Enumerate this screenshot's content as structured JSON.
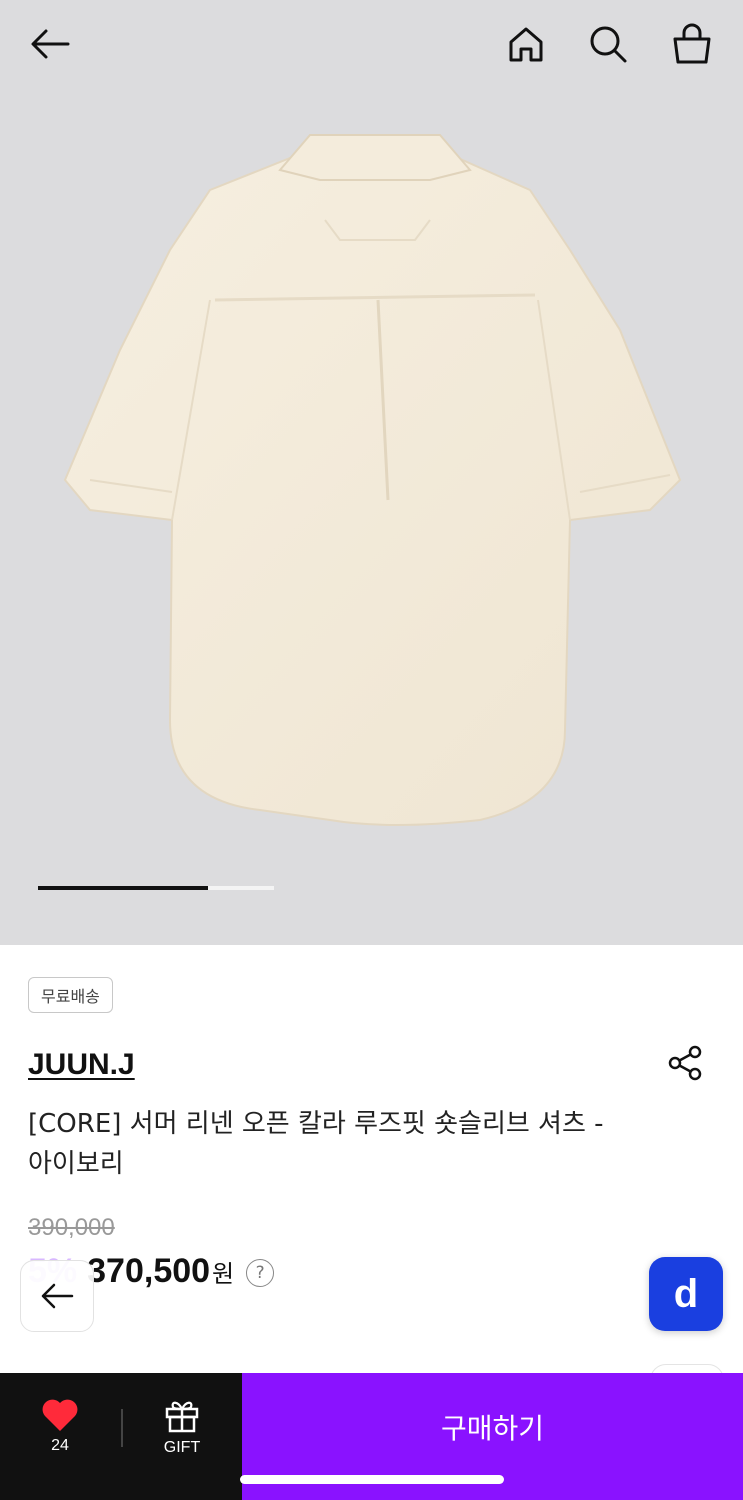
{
  "gallery": {
    "progress": 0.72
  },
  "shipping_badge": "무료배송",
  "brand": "JUUN.J",
  "product_title": "[CORE] 서머 리넨 오픈 칼라 루즈핏 숏슬리브 셔츠 - 아이보리",
  "original_price": "390,000",
  "discount": "5%",
  "sale_price": "370,500",
  "currency": "원",
  "help_glyph": "?",
  "d_button_label": "d",
  "bottom_bar": {
    "like_count": "24",
    "gift_label": "GIFT",
    "buy_label": "구매하기"
  },
  "colors": {
    "buy": "#8a12ff",
    "discount": "#d8b8ff",
    "d_button": "#1a3fe0",
    "heart": "#ff2a3a"
  }
}
